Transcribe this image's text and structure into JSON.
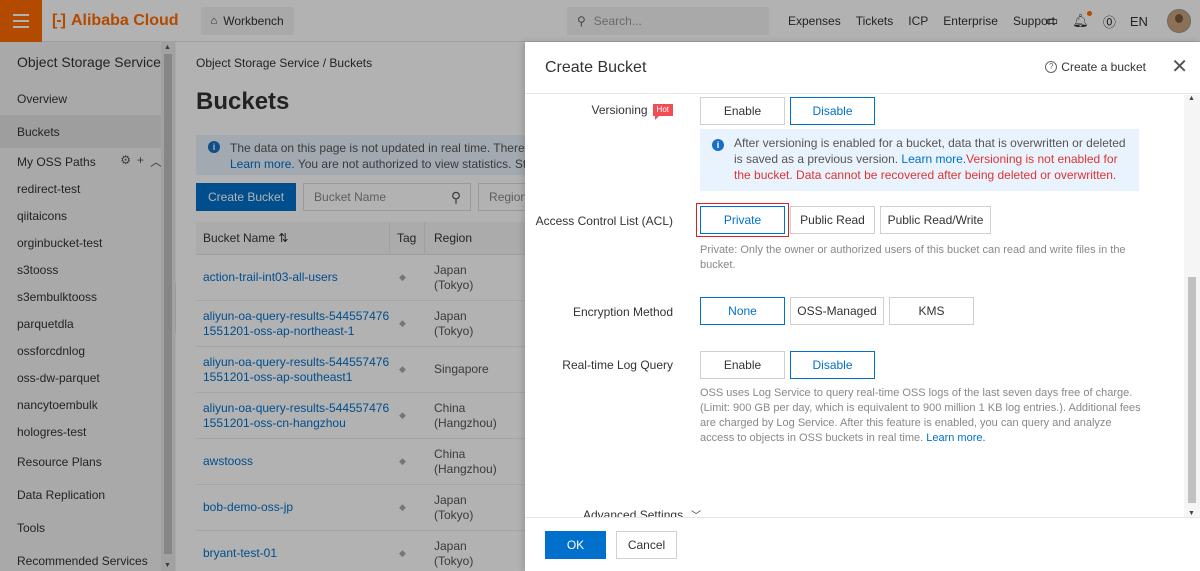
{
  "topbar": {
    "brand": "Alibaba Cloud",
    "brand_mark": "[-]",
    "workbench": "Workbench",
    "search_placeholder": "Search...",
    "links": [
      "Expenses",
      "Tickets",
      "ICP",
      "Enterprise",
      "Support"
    ],
    "language": "EN"
  },
  "sidebar": {
    "title": "Object Storage Service",
    "items_top": [
      "Overview",
      "Buckets"
    ],
    "oss_paths_label": "My OSS Paths",
    "paths": [
      "redirect-test",
      "qiitaicons",
      "orginbucket-test",
      "s3tooss",
      "s3embulktooss",
      "parquetdla",
      "ossforcdnlog",
      "oss-dw-parquet",
      "nancytoembulk",
      "hologres-test"
    ],
    "items_bottom": [
      "Resource Plans",
      "Data Replication",
      "Tools",
      "Recommended Services"
    ]
  },
  "main": {
    "breadcrumb": "Object Storage Service  /  Buckets",
    "title": "Buckets",
    "notice_line1": "The data on this page is not updated in real time. There is a l",
    "notice_link": "Learn more.",
    "notice_line2": " You are not authorized to view statistics. Statistic",
    "create_button": "Create Bucket",
    "bucket_name_placeholder": "Bucket Name",
    "region_filter": "Region",
    "columns": {
      "name": "Bucket Name ⇅",
      "tag": "Tag",
      "region": "Region"
    },
    "rows": [
      {
        "name": "action-trail-int03-all-users",
        "region": "Japan (Tokyo)"
      },
      {
        "name": "aliyun-oa-query-results-5445574761551201-oss-ap-northeast-1",
        "region": "Japan (Tokyo)"
      },
      {
        "name": "aliyun-oa-query-results-5445574761551201-oss-ap-southeast1",
        "region": "Singapore"
      },
      {
        "name": "aliyun-oa-query-results-5445574761551201-oss-cn-hangzhou",
        "region": "China (Hangzhou)"
      },
      {
        "name": "awstooss",
        "region": "China (Hangzhou)"
      },
      {
        "name": "bob-demo-oss-jp",
        "region": "Japan (Tokyo)"
      },
      {
        "name": "bryant-test-01",
        "region": "Japan (Tokyo)"
      }
    ]
  },
  "drawer": {
    "title": "Create Bucket",
    "help_link": "Create a bucket",
    "versioning": {
      "label": "Versioning",
      "badge": "Hot",
      "options": [
        "Enable",
        "Disable"
      ],
      "selected": "Disable",
      "info_text": "After versioning is enabled for a bucket, data that is overwritten or deleted is saved as a previous version. ",
      "info_link": "Learn more.",
      "info_warning": "Versioning is not enabled for the bucket. Data cannot be recovered after being deleted or overwritten."
    },
    "acl": {
      "label": "Access Control List (ACL)",
      "options": [
        "Private",
        "Public Read",
        "Public Read/Write"
      ],
      "selected": "Private",
      "help": "Private: Only the owner or authorized users of this bucket can read and write files in the bucket."
    },
    "encryption": {
      "label": "Encryption Method",
      "options": [
        "None",
        "OSS-Managed",
        "KMS"
      ],
      "selected": "None"
    },
    "log_query": {
      "label": "Real-time Log Query",
      "options": [
        "Enable",
        "Disable"
      ],
      "selected": "Disable",
      "help": "OSS uses Log Service to query real-time OSS logs of the last seven days free of charge. (Limit: 900 GB per day, which is equivalent to 900 million 1 KB log entries.). Additional fees are charged by Log Service. After this feature is enabled, you can query and analyze access to objects in OSS buckets in real time. ",
      "help_link": "Learn more."
    },
    "advanced": "Advanced Settings",
    "ok": "OK",
    "cancel": "Cancel"
  },
  "colors": {
    "brand": "#ff6a00",
    "primary": "#0070cc",
    "warning": "#e03333",
    "highlight": "#e02020"
  },
  "icons": [
    "menu-icon",
    "home-icon",
    "search-icon",
    "terminal-icon",
    "bell-icon",
    "help-icon",
    "gear-icon",
    "plus-icon",
    "chevron-up-icon",
    "tag-icon",
    "info-icon",
    "close-icon",
    "chevron-down-icon"
  ]
}
